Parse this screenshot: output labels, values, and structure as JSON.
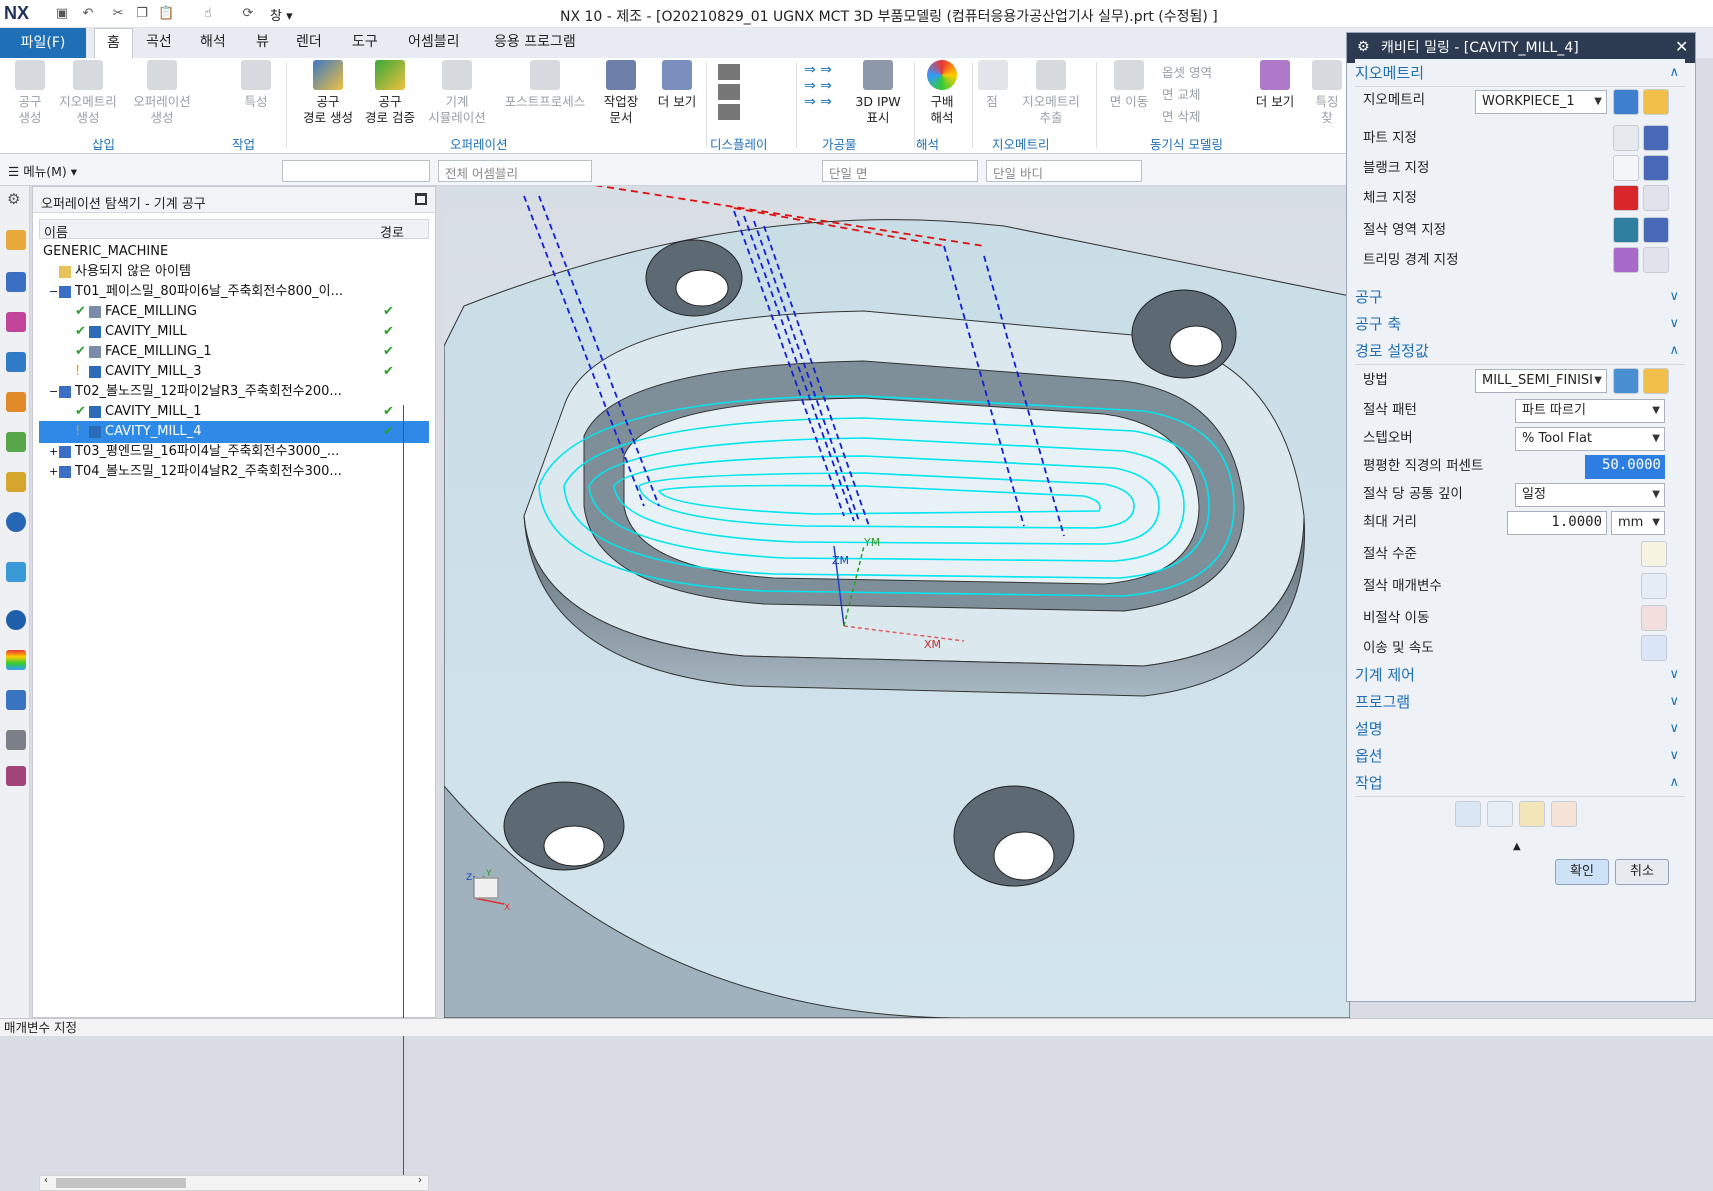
{
  "window": {
    "title": "NX 10 - 제조 - [O20210829_01 UGNX MCT 3D 부품모델링 (컴퓨터응용가공산업기사 실무).prt (수정됨) ]",
    "logo": "NX",
    "window_menu": "창"
  },
  "ribbon_tabs": {
    "file": "파일(F)",
    "tabs": [
      "홈",
      "곡선",
      "해석",
      "뷰",
      "렌더",
      "도구",
      "어셈블리",
      "응용 프로그램"
    ]
  },
  "ribbon": {
    "buttons": [
      {
        "label": "공구\n생성",
        "enabled": false
      },
      {
        "label": "지오메트리\n생성",
        "enabled": false
      },
      {
        "label": "오퍼레이션\n생성",
        "enabled": false
      },
      {
        "label": "특성",
        "enabled": false
      },
      {
        "label": "공구\n경로 생성",
        "enabled": true
      },
      {
        "label": "공구\n경로 검증",
        "enabled": true
      },
      {
        "label": "기계\n시뮬레이션",
        "enabled": false
      },
      {
        "label": "포스트프로세스",
        "enabled": false
      },
      {
        "label": "작업장\n문서",
        "enabled": true
      },
      {
        "label": "더 보기",
        "enabled": true
      },
      {
        "label": "3D IPW\n표시",
        "enabled": true
      },
      {
        "label": "구배\n해석",
        "enabled": true
      },
      {
        "label": "점",
        "enabled": false
      },
      {
        "label": "지오메트리\n추출",
        "enabled": false
      },
      {
        "label": "면 이동",
        "enabled": false
      },
      {
        "label": "옵셋 영역",
        "enabled": false
      },
      {
        "label": "면 교체",
        "enabled": false
      },
      {
        "label": "면 삭제",
        "enabled": false
      },
      {
        "label": "더 보기",
        "enabled": true
      },
      {
        "label": "특징\n찾",
        "enabled": false
      }
    ],
    "groups": [
      "삽입",
      "작업",
      "오퍼레이션",
      "디스플레이",
      "가공물",
      "해석",
      "지오메트리",
      "동기식 모델링"
    ]
  },
  "toolbar2": {
    "menu": "메뉴(M)",
    "filter_placeholder": "",
    "scope": "전체 어셈블리",
    "face_rule": "단일 면",
    "body_rule": "단일 바디"
  },
  "navigator": {
    "title": "오퍼레이션 탐색기 - 기계 공구",
    "col_name": "이름",
    "col_path": "경로",
    "rows": [
      {
        "indent": 0,
        "icon": "none",
        "label": "GENERIC_MACHINE",
        "status": "",
        "path": ""
      },
      {
        "indent": 1,
        "icon": "folder",
        "label": "사용되지 않은 아이템",
        "status": "",
        "path": ""
      },
      {
        "indent": 1,
        "icon": "tool",
        "label": "T01_페이스밀_80파이6날_주축회전수800_이...",
        "status": "",
        "path": "",
        "expand": "−"
      },
      {
        "indent": 2,
        "icon": "face",
        "label": "FACE_MILLING",
        "status": "ok",
        "path": "✔"
      },
      {
        "indent": 2,
        "icon": "cavity",
        "label": "CAVITY_MILL",
        "status": "ok",
        "path": "✔"
      },
      {
        "indent": 2,
        "icon": "face",
        "label": "FACE_MILLING_1",
        "status": "ok",
        "path": "✔"
      },
      {
        "indent": 2,
        "icon": "cavity",
        "label": "CAVITY_MILL_3",
        "status": "warn",
        "path": "✔"
      },
      {
        "indent": 1,
        "icon": "tool",
        "label": "T02_볼노즈밀_12파이2날R3_주축회전수200...",
        "status": "",
        "path": "",
        "expand": "−"
      },
      {
        "indent": 2,
        "icon": "cavity",
        "label": "CAVITY_MILL_1",
        "status": "ok",
        "path": "✔"
      },
      {
        "indent": 2,
        "icon": "cavity",
        "label": "CAVITY_MILL_4",
        "status": "warn",
        "path": "✔",
        "selected": true
      },
      {
        "indent": 1,
        "icon": "tool",
        "label": "T03_평엔드밀_16파이4날_주축회전수3000_...",
        "status": "",
        "path": "",
        "expand": "+"
      },
      {
        "indent": 1,
        "icon": "tool",
        "label": "T04_볼노즈밀_12파이4날R2_주축회전수300...",
        "status": "",
        "path": "",
        "expand": "+"
      }
    ]
  },
  "viewport": {
    "axis_labels": {
      "zm": "ZM",
      "ym": "YM",
      "xm": "XM",
      "x": "X",
      "y": "Y",
      "z": "Z"
    }
  },
  "dialog": {
    "title": "캐비티 밀링 - [CAVITY_MILL_4]",
    "sections": {
      "geometry": "지오메트리",
      "tool": "공구",
      "tool_axis": "공구 축",
      "path_settings": "경로 설정값",
      "machine_control": "기계 제어",
      "program": "프로그램",
      "description": "설명",
      "options": "옵션",
      "actions": "작업"
    },
    "geometry_rows": {
      "geometry_label": "지오메트리",
      "geometry_value": "WORKPIECE_1",
      "part": "파트 지정",
      "blank": "블랭크 지정",
      "check": "체크 지정",
      "cut_area": "절삭 영역 지정",
      "trim": "트리밍 경계 지정"
    },
    "path_rows": {
      "method_label": "방법",
      "method_value": "MILL_SEMI_FINISI",
      "pattern_label": "절삭 패턴",
      "pattern_value": "파트 따르기",
      "stepover_label": "스텝오버",
      "stepover_value": "% Tool Flat",
      "percent_label": "평평한 직경의 퍼센트",
      "percent_value": "50.0000",
      "depth_label": "절삭 당 공통 깊이",
      "depth_value": "일정",
      "maxdist_label": "최대 거리",
      "maxdist_value": "1.0000",
      "maxdist_unit": "mm",
      "levels": "절삭 수준",
      "params": "절삭 매개변수",
      "noncut": "비절삭 이동",
      "feeds": "이송 및 속도"
    },
    "ok": "확인",
    "cancel": "취소"
  },
  "status_bar": "매개변수 지정",
  "colors": {
    "accent": "#1e6fb6",
    "selection": "#2e8ae6",
    "toolpath": "#00e5ee",
    "dialog_title": "#2c3a52",
    "check": "#2ca02c"
  }
}
